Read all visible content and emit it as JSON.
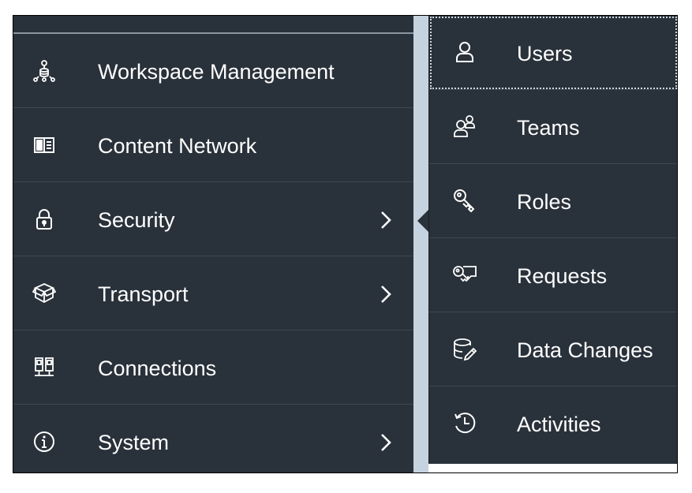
{
  "left_menu": {
    "items": [
      {
        "label": "Workspace Management",
        "icon": "workspace-hierarchy-icon",
        "has_submenu": false
      },
      {
        "label": "Content Network",
        "icon": "book-icon",
        "has_submenu": false
      },
      {
        "label": "Security",
        "icon": "lock-icon",
        "has_submenu": true,
        "active": true
      },
      {
        "label": "Transport",
        "icon": "package-icon",
        "has_submenu": true
      },
      {
        "label": "Connections",
        "icon": "connections-icon",
        "has_submenu": false
      },
      {
        "label": "System",
        "icon": "info-icon",
        "has_submenu": true
      }
    ]
  },
  "submenu": {
    "items": [
      {
        "label": "Users",
        "icon": "user-icon",
        "focused": true
      },
      {
        "label": "Teams",
        "icon": "group-icon"
      },
      {
        "label": "Roles",
        "icon": "key-icon"
      },
      {
        "label": "Requests",
        "icon": "key-request-icon"
      },
      {
        "label": "Data Changes",
        "icon": "database-edit-icon"
      },
      {
        "label": "Activities",
        "icon": "history-icon"
      }
    ]
  },
  "colors": {
    "menu_background": "#29313a",
    "divider": "#3e4852",
    "text": "#ffffff",
    "backdrop": "#c5d3e0"
  }
}
